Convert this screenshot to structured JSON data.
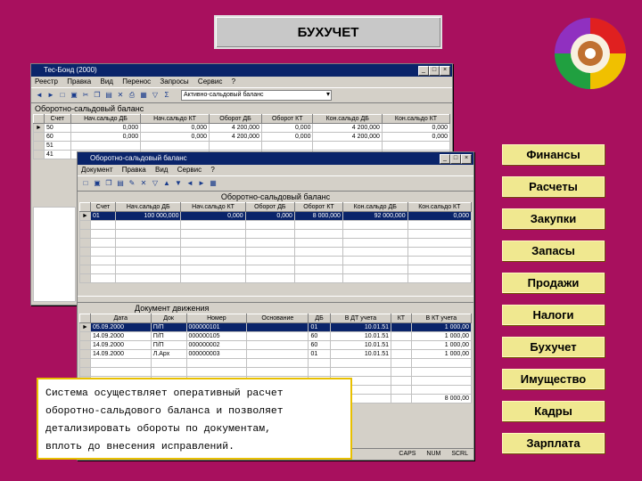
{
  "slide_title": "БУХУЧЕТ",
  "back_window": {
    "title": "Тес-Бонд (2000)",
    "menu": [
      "Реестр",
      "Правка",
      "Вид",
      "Перенос",
      "Запросы",
      "Сервис",
      "?"
    ],
    "combo_value": "Активно-сальдовый баланс",
    "sub_header": "Оборотно-сальдовый баланс",
    "columns": [
      "Счет",
      "Нач.сальдо ДБ",
      "Нач.сальдо КТ",
      "Оборот ДБ",
      "Оборот КТ",
      "Кон.сальдо ДБ",
      "Кон.сальдо КТ"
    ],
    "rows": [
      [
        "50",
        "0,000",
        "0,000",
        "4 200,000",
        "0,000",
        "4 200,000",
        "0,000"
      ],
      [
        "60",
        "0,000",
        "0,000",
        "4 200,000",
        "0,000",
        "4 200,000",
        "0,000"
      ]
    ],
    "extra_accounts": [
      "51",
      "41"
    ]
  },
  "front_window": {
    "title": "Оборотно-сальдовый баланс",
    "menu": [
      "Документ",
      "Правка",
      "Вид",
      "Сервис",
      "?"
    ],
    "sub_header": "Оборотно-сальдовый баланс",
    "columns": [
      "Счет",
      "Нач.сальдо ДБ",
      "Нач.сальдо КТ",
      "Оборот ДБ",
      "Оборот КТ",
      "Кон.сальдо ДБ",
      "Кон.сальдо КТ"
    ],
    "rows": [
      [
        "01",
        "100 000,000",
        "0,000",
        "0,000",
        "8 000,000",
        "92 000,000",
        "0,000"
      ]
    ],
    "movement_header": "Документ движения",
    "movement_columns": [
      "Дата",
      "Док",
      "Номер",
      "Основание",
      "ДБ",
      "В ДТ учета",
      "КТ",
      "В КТ учета"
    ],
    "movement_rows": [
      [
        "05.09.2000",
        "П/П",
        "000000101",
        "",
        "01",
        "10.01.51",
        "",
        "1 000,00"
      ],
      [
        "14.09.2000",
        "П/П",
        "000000105",
        "",
        "60",
        "10.01.51",
        "",
        "1 000,00"
      ],
      [
        "14.09.2000",
        "П/П",
        "000000002",
        "",
        "60",
        "10.01.51",
        "",
        "1 000,00"
      ],
      [
        "14.09.2000",
        "Л.Арх",
        "000000003",
        "",
        "01",
        "10.01.51",
        "",
        "1 000,00"
      ]
    ],
    "total_value": "8 000,00",
    "status_items": [
      "CAPS",
      "NUM",
      "SCRL"
    ]
  },
  "nav_buttons": [
    "Финансы",
    "Расчеты",
    "Закупки",
    "Запасы",
    "Продажи",
    "Налоги",
    "Бухучет",
    "Имущество",
    "Кадры",
    "Зарплата"
  ],
  "description": [
    "Система осуществляет оперативный расчет",
    "оборотно-сальдового баланса и позволяет",
    "детализировать обороты по документам,",
    "вплоть до внесения исправлений."
  ]
}
